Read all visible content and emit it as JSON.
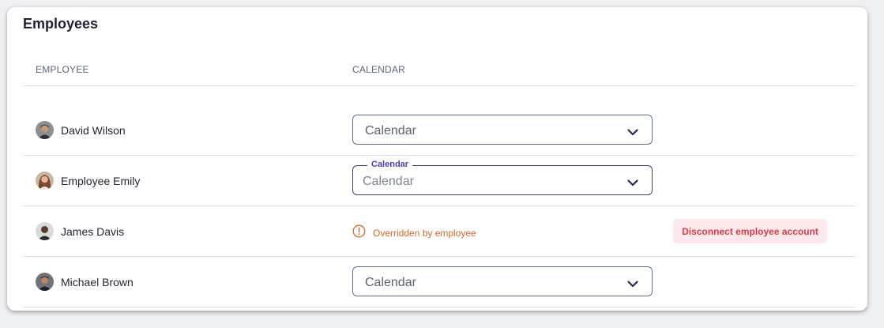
{
  "section": {
    "title": "Employees"
  },
  "table": {
    "headers": {
      "employee": "EMPLOYEE",
      "calendar": "CALENDAR"
    },
    "rows": [
      {
        "name": "David Wilson",
        "calendar_value": "Calendar",
        "state": "default"
      },
      {
        "name": "Employee Emily",
        "calendar_label": "Calendar",
        "calendar_value": "Calendar",
        "state": "focused"
      },
      {
        "name": "James Davis",
        "override_text": "Overridden by employee",
        "action_label": "Disconnect employee account",
        "state": "overridden"
      },
      {
        "name": "Michael Brown",
        "calendar_value": "Calendar",
        "state": "default"
      }
    ]
  },
  "icons": {
    "chevron": "chevron-down-icon",
    "override": "alert-circle-icon"
  },
  "colors": {
    "accent": "#4b40a8",
    "warning": "#d4672b",
    "danger_text": "#d83c46",
    "danger_bg": "#fde9ec",
    "border": "#5b6f96"
  }
}
